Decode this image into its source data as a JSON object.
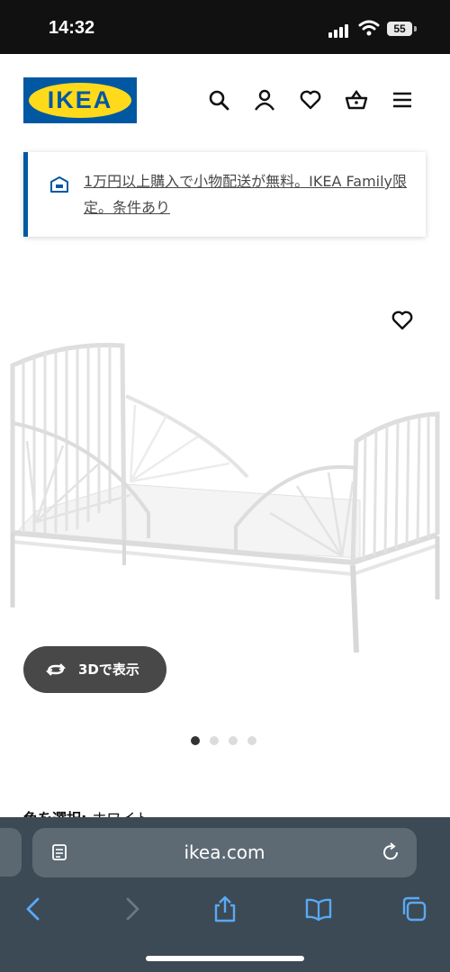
{
  "status": {
    "time": "14:32",
    "battery": "55"
  },
  "header": {
    "logo_text": "IKEA",
    "icons": [
      "search-icon",
      "account-icon",
      "heart-icon",
      "basket-icon",
      "menu-icon"
    ]
  },
  "promo": {
    "text": "1万円以上購入で小物配送が無料。IKEA Family限定。条件あり",
    "icon": "truck-icon"
  },
  "product": {
    "image_alt": "white metal extendable children's bed",
    "view_3d_label": "3Dで表示",
    "carousel": {
      "count": 4,
      "active": 1
    },
    "color_label": "色を選択:",
    "color_value": "ホワイト"
  },
  "browser": {
    "url": "ikea.com",
    "toolbar": [
      "back-icon",
      "forward-icon",
      "share-icon",
      "bookmarks-icon",
      "tabs-icon"
    ]
  },
  "colors": {
    "ikea_blue": "#0058a3",
    "ikea_yellow": "#ffda1a",
    "browser_bar": "#3c4a55",
    "link_blue": "#5aa9f5"
  }
}
